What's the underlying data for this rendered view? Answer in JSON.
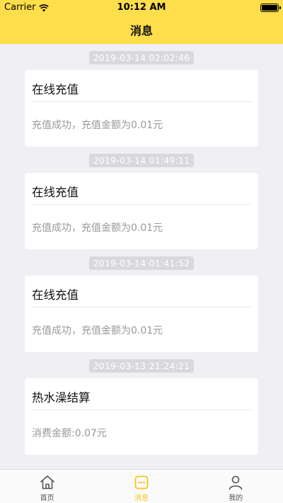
{
  "status_bar": {
    "carrier": "Carrier",
    "time": "10:12 AM"
  },
  "header": {
    "title": "消息",
    "background": "#ffde4b"
  },
  "messages": [
    {
      "time": "2019-03-14 02:02:46",
      "title": "在线充值",
      "body": "充值成功，充值金额为0.01元"
    },
    {
      "time": "2019-03-14 01:49:11",
      "title": "在线充值",
      "body": "充值成功，充值金额为0.01元"
    },
    {
      "time": "2019-03-14 01:41:52",
      "title": "在线充值",
      "body": "充值成功，充值金额为0.01元"
    },
    {
      "time": "2019-03-13 21:24:21",
      "title": "热水澡结算",
      "body": "消费金额:0.07元"
    }
  ],
  "tabbar": {
    "items": [
      {
        "label": "首页",
        "icon": "home-icon",
        "active": false
      },
      {
        "label": "消息",
        "icon": "message-icon",
        "active": true
      },
      {
        "label": "我的",
        "icon": "user-icon",
        "active": false
      }
    ],
    "active_color": "#f5c518"
  }
}
